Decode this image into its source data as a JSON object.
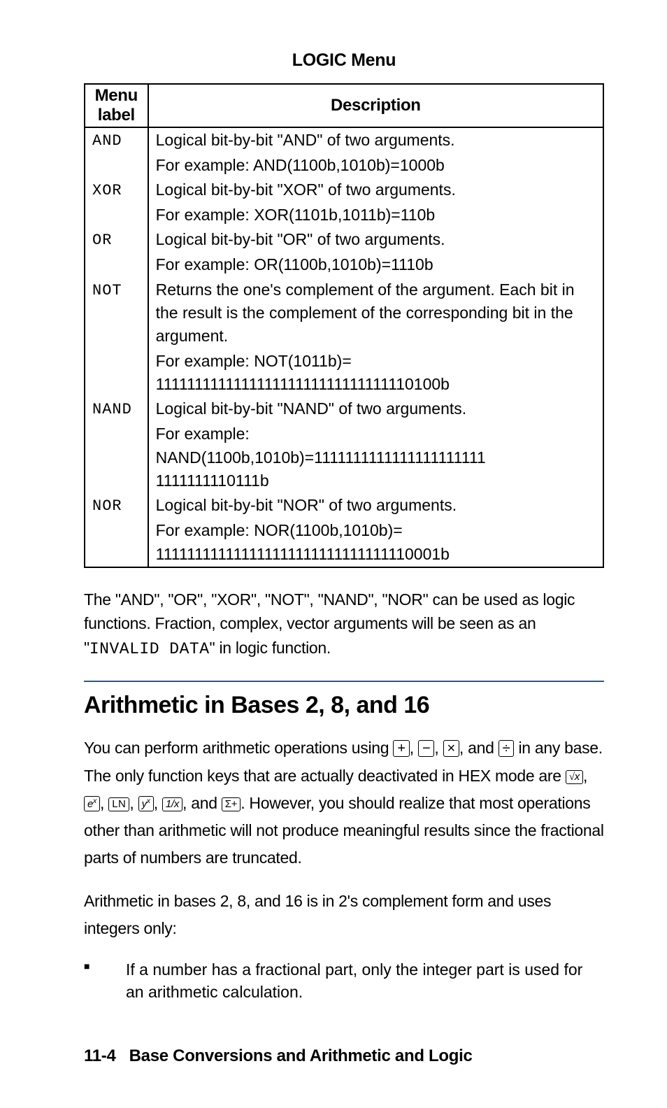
{
  "tableTitle": "LOGIC Menu",
  "headers": {
    "col1": "Menu label",
    "col2": "Description"
  },
  "rows": [
    {
      "label": "AND",
      "desc1": "Logical bit-by-bit \"AND\" of two arguments.",
      "desc2": "For example: AND(1100b,1010b)=1000b"
    },
    {
      "label": "XOR",
      "desc1": "Logical bit-by-bit \"XOR\" of two arguments.",
      "desc2": "For example: XOR(1101b,1011b)=110b"
    },
    {
      "label": "OR",
      "desc1": "Logical bit-by-bit \"OR\" of two arguments.",
      "desc2": "For example: OR(1100b,1010b)=1110b"
    },
    {
      "label": "NOT",
      "desc1": "Returns the one's complement of the argument. Each bit in the result is the complement of the corresponding bit in the argument.",
      "desc2": "For example: NOT(1011b)=",
      "desc3": "111111111111111111111111111111110100b"
    },
    {
      "label": "NAND",
      "desc1": "Logical bit-by-bit \"NAND\" of two arguments.",
      "desc2": "For example:",
      "desc3": "NAND(1100b,1010b)=1111111111111111111111",
      "desc4": "1111111110111b"
    },
    {
      "label": "NOR",
      "desc1": "Logical bit-by-bit \"NOR\" of two arguments.",
      "desc2": "For example: NOR(1100b,1010b)=",
      "desc3": "111111111111111111111111111111110001b"
    }
  ],
  "afterTable": {
    "p1a": "The \"AND\", \"OR\", \"XOR\", \"NOT\", \"NAND\", \"NOR\" can be used as logic functions. Fraction, complex, vector arguments will be seen as an \"",
    "p1code": "INVALID DATA",
    "p1b": "\" in logic function."
  },
  "sectionHead": "Arithmetic in Bases 2, 8, and 16",
  "arithIntro": {
    "t1": "You can perform arithmetic operations using ",
    "t2": ", ",
    "t3": ", ",
    "t4": ", and ",
    "t5": " in any base. The only function keys that are actually deactivated in HEX mode are ",
    "t6": ", ",
    "t7": ", ",
    "t8": ", ",
    "t9": ", ",
    "t10": ", and ",
    "t11": ". However, you should realize that most operations other than arithmetic will not produce meaningful results since the fractional parts of numbers are truncated."
  },
  "arithPara2": "Arithmetic in bases 2, 8, and 16 is in 2's complement form and uses integers only:",
  "bullet1": "If a number has a fractional part, only the integer part is used for an arithmetic calculation.",
  "footer": {
    "pageNum": "11-4",
    "title": "Base Conversions and Arithmetic and Logic"
  },
  "keys": {
    "plus": "+",
    "minus": "−",
    "times": "×",
    "divide": "÷",
    "ln": "LN",
    "sigma": "Σ+"
  }
}
